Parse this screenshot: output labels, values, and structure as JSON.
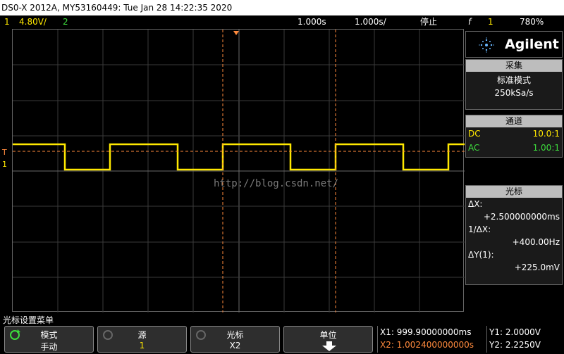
{
  "title": "DS0-X 2012A, MY53160449: Tue Jan 28 14:22:35 2020",
  "status": {
    "ch1_num": "1",
    "ch1_scale": "4.80V/",
    "ch2_num": "2",
    "timebase": "1.000s",
    "delay": "1.000s/",
    "run_state": "停止",
    "trig_symbol": "f",
    "trig_channel": "1",
    "trig_level": "780%"
  },
  "brand": "Agilent",
  "acquire": {
    "header": "采集",
    "mode": "标准模式",
    "rate": "250kSa/s"
  },
  "channels": {
    "header": "通道",
    "rows": [
      {
        "coupling": "DC",
        "probe": "10.0:1",
        "color": "#ffe800"
      },
      {
        "coupling": "AC",
        "probe": "1.00:1",
        "color": "#3ddc3d"
      }
    ]
  },
  "cursors": {
    "header": "光标",
    "dx_label": "ΔX:",
    "dx_value": "+2.500000000ms",
    "inv_label": "1/ΔX:",
    "inv_value": "+400.00Hz",
    "dy_label": "ΔY(1):",
    "dy_value": "+225.0mV"
  },
  "menu_title": "光标设置菜单",
  "softkeys": [
    {
      "top": "模式",
      "bottom": "手动"
    },
    {
      "top": "源",
      "bottom": "1"
    },
    {
      "top": "光标",
      "bottom": "X2"
    },
    {
      "top": "单位",
      "bottom": ""
    }
  ],
  "readouts": {
    "x1": "X1: 999.90000000ms",
    "x2": "X2: 1.002400000000s",
    "y1": "Y1: 2.0000V",
    "y2": "Y2: 2.2250V"
  },
  "watermark": "http://blog.csdn.net/",
  "ch1_marker": "1"
}
